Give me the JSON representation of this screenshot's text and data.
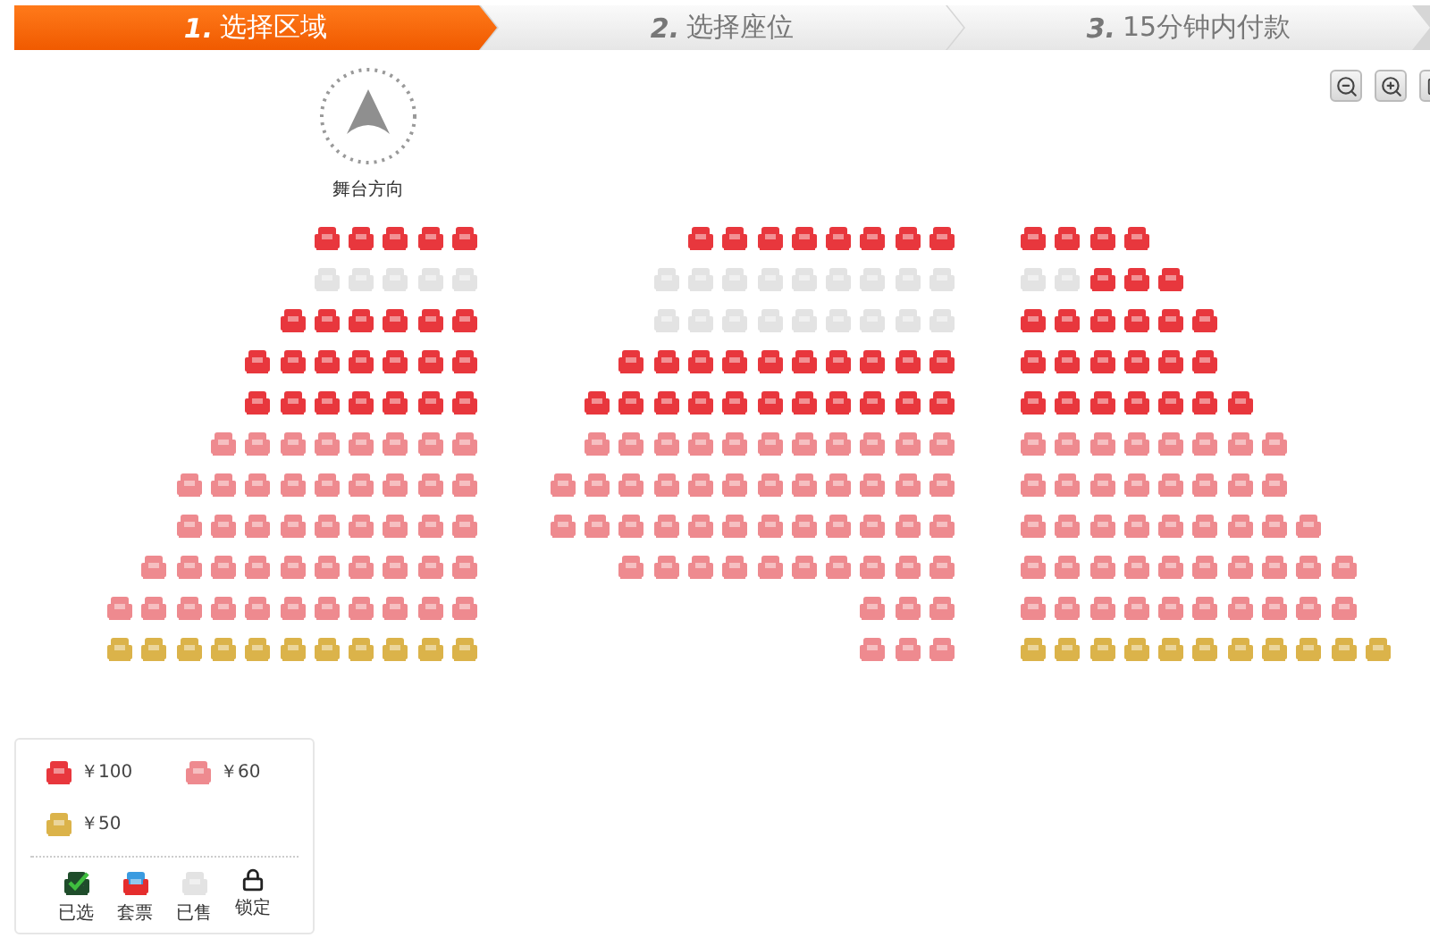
{
  "steps": [
    {
      "number": "1.",
      "label": "选择区域",
      "selected": true
    },
    {
      "number": "2.",
      "label": "选择座位",
      "selected": false
    },
    {
      "number": "3.",
      "label": "15分钟内付款",
      "selected": false
    }
  ],
  "stage": {
    "label": "舞台方向"
  },
  "zoom_buttons": [
    {
      "kind": "zoom-out"
    },
    {
      "kind": "zoom-in"
    },
    {
      "kind": "view"
    }
  ],
  "blocks": [
    {
      "kind": "left-wing",
      "rows": [
        {
          "seats": [
            {
              "kind": "tier1"
            },
            {
              "kind": "tier1"
            },
            {
              "kind": "tier1"
            },
            {
              "kind": "tier1"
            },
            {
              "kind": "tier1"
            }
          ]
        },
        {
          "seats": [
            {
              "kind": "sold"
            },
            {
              "kind": "sold"
            },
            {
              "kind": "sold"
            },
            {
              "kind": "sold"
            },
            {
              "kind": "sold"
            }
          ]
        },
        {
          "seats": [
            {
              "kind": "tier1"
            },
            {
              "kind": "tier1"
            },
            {
              "kind": "tier1"
            },
            {
              "kind": "tier1"
            },
            {
              "kind": "tier1"
            },
            {
              "kind": "tier1"
            }
          ]
        },
        {
          "seats": [
            {
              "kind": "tier1"
            },
            {
              "kind": "tier1"
            },
            {
              "kind": "tier1"
            },
            {
              "kind": "tier1"
            },
            {
              "kind": "tier1"
            },
            {
              "kind": "tier1"
            },
            {
              "kind": "tier1"
            }
          ]
        },
        {
          "seats": [
            {
              "kind": "tier1"
            },
            {
              "kind": "tier1"
            },
            {
              "kind": "tier1"
            },
            {
              "kind": "tier1"
            },
            {
              "kind": "tier1"
            },
            {
              "kind": "tier1"
            },
            {
              "kind": "tier1"
            }
          ]
        },
        {
          "seats": [
            {
              "kind": "tier2"
            },
            {
              "kind": "tier2"
            },
            {
              "kind": "tier2"
            },
            {
              "kind": "tier2"
            },
            {
              "kind": "tier2"
            },
            {
              "kind": "tier2"
            },
            {
              "kind": "tier2"
            },
            {
              "kind": "tier2"
            }
          ]
        },
        {
          "seats": [
            {
              "kind": "tier2"
            },
            {
              "kind": "tier2"
            },
            {
              "kind": "tier2"
            },
            {
              "kind": "tier2"
            },
            {
              "kind": "tier2"
            },
            {
              "kind": "tier2"
            },
            {
              "kind": "tier2"
            },
            {
              "kind": "tier2"
            },
            {
              "kind": "tier2"
            }
          ]
        },
        {
          "seats": [
            {
              "kind": "tier2"
            },
            {
              "kind": "tier2"
            },
            {
              "kind": "tier2"
            },
            {
              "kind": "tier2"
            },
            {
              "kind": "tier2"
            },
            {
              "kind": "tier2"
            },
            {
              "kind": "tier2"
            },
            {
              "kind": "tier2"
            },
            {
              "kind": "tier2"
            }
          ]
        },
        {
          "seats": [
            {
              "kind": "tier2"
            },
            {
              "kind": "tier2"
            },
            {
              "kind": "tier2"
            },
            {
              "kind": "tier2"
            },
            {
              "kind": "tier2"
            },
            {
              "kind": "tier2"
            },
            {
              "kind": "tier2"
            },
            {
              "kind": "tier2"
            },
            {
              "kind": "tier2"
            },
            {
              "kind": "tier2"
            }
          ]
        },
        {
          "seats": [
            {
              "kind": "tier2"
            },
            {
              "kind": "tier2"
            },
            {
              "kind": "tier2"
            },
            {
              "kind": "tier2"
            },
            {
              "kind": "tier2"
            },
            {
              "kind": "tier2"
            },
            {
              "kind": "tier2"
            },
            {
              "kind": "tier2"
            },
            {
              "kind": "tier2"
            },
            {
              "kind": "tier2"
            },
            {
              "kind": "tier2"
            }
          ]
        },
        {
          "seats": [
            {
              "kind": "tier3"
            },
            {
              "kind": "tier3"
            },
            {
              "kind": "tier3"
            },
            {
              "kind": "tier3"
            },
            {
              "kind": "tier3"
            },
            {
              "kind": "tier3"
            },
            {
              "kind": "tier3"
            },
            {
              "kind": "tier3"
            },
            {
              "kind": "tier3"
            },
            {
              "kind": "tier3"
            },
            {
              "kind": "tier3"
            }
          ]
        }
      ]
    },
    {
      "kind": "centre",
      "rows": [
        {
          "seats": [
            {
              "kind": "tier1"
            },
            {
              "kind": "tier1"
            },
            {
              "kind": "tier1"
            },
            {
              "kind": "tier1"
            },
            {
              "kind": "tier1"
            },
            {
              "kind": "tier1"
            },
            {
              "kind": "tier1"
            },
            {
              "kind": "tier1"
            }
          ]
        },
        {
          "seats": [
            {
              "kind": "sold"
            },
            {
              "kind": "sold"
            },
            {
              "kind": "sold"
            },
            {
              "kind": "sold"
            },
            {
              "kind": "sold"
            },
            {
              "kind": "sold"
            },
            {
              "kind": "sold"
            },
            {
              "kind": "sold"
            },
            {
              "kind": "sold"
            }
          ]
        },
        {
          "seats": [
            {
              "kind": "sold"
            },
            {
              "kind": "sold"
            },
            {
              "kind": "sold"
            },
            {
              "kind": "sold"
            },
            {
              "kind": "sold"
            },
            {
              "kind": "sold"
            },
            {
              "kind": "sold"
            },
            {
              "kind": "sold"
            },
            {
              "kind": "sold"
            }
          ]
        },
        {
          "seats": [
            {
              "kind": "tier1"
            },
            {
              "kind": "tier1"
            },
            {
              "kind": "tier1"
            },
            {
              "kind": "tier1"
            },
            {
              "kind": "tier1"
            },
            {
              "kind": "tier1"
            },
            {
              "kind": "tier1"
            },
            {
              "kind": "tier1"
            },
            {
              "kind": "tier1"
            },
            {
              "kind": "tier1"
            }
          ]
        },
        {
          "seats": [
            {
              "kind": "tier1"
            },
            {
              "kind": "tier1"
            },
            {
              "kind": "tier1"
            },
            {
              "kind": "tier1"
            },
            {
              "kind": "tier1"
            },
            {
              "kind": "tier1"
            },
            {
              "kind": "tier1"
            },
            {
              "kind": "tier1"
            },
            {
              "kind": "tier1"
            },
            {
              "kind": "tier1"
            },
            {
              "kind": "tier1"
            }
          ]
        },
        {
          "seats": [
            {
              "kind": "tier2"
            },
            {
              "kind": "tier2"
            },
            {
              "kind": "tier2"
            },
            {
              "kind": "tier2"
            },
            {
              "kind": "tier2"
            },
            {
              "kind": "tier2"
            },
            {
              "kind": "tier2"
            },
            {
              "kind": "tier2"
            },
            {
              "kind": "tier2"
            },
            {
              "kind": "tier2"
            },
            {
              "kind": "tier2"
            }
          ]
        },
        {
          "seats": [
            {
              "kind": "tier2"
            },
            {
              "kind": "tier2"
            },
            {
              "kind": "tier2"
            },
            {
              "kind": "tier2"
            },
            {
              "kind": "tier2"
            },
            {
              "kind": "tier2"
            },
            {
              "kind": "tier2"
            },
            {
              "kind": "tier2"
            },
            {
              "kind": "tier2"
            },
            {
              "kind": "tier2"
            },
            {
              "kind": "tier2"
            },
            {
              "kind": "tier2"
            }
          ]
        },
        {
          "seats": [
            {
              "kind": "tier2"
            },
            {
              "kind": "tier2"
            },
            {
              "kind": "tier2"
            },
            {
              "kind": "tier2"
            },
            {
              "kind": "tier2"
            },
            {
              "kind": "tier2"
            },
            {
              "kind": "tier2"
            },
            {
              "kind": "tier2"
            },
            {
              "kind": "tier2"
            },
            {
              "kind": "tier2"
            },
            {
              "kind": "tier2"
            },
            {
              "kind": "tier2"
            }
          ]
        },
        {
          "seats": [
            {
              "kind": "tier2"
            },
            {
              "kind": "tier2"
            },
            {
              "kind": "tier2"
            },
            {
              "kind": "tier2"
            },
            {
              "kind": "tier2"
            },
            {
              "kind": "tier2"
            },
            {
              "kind": "tier2"
            },
            {
              "kind": "tier2"
            },
            {
              "kind": "tier2"
            },
            {
              "kind": "tier2"
            }
          ]
        },
        {
          "seats": [
            {
              "kind": "tier2"
            },
            {
              "kind": "tier2"
            },
            {
              "kind": "tier2"
            }
          ]
        },
        {
          "seats": [
            {
              "kind": "tier2"
            },
            {
              "kind": "tier2"
            },
            {
              "kind": "tier2"
            }
          ]
        }
      ]
    },
    {
      "kind": "right-wing",
      "rows": [
        {
          "seats": [
            {
              "kind": "tier1"
            },
            {
              "kind": "tier1"
            },
            {
              "kind": "tier1"
            },
            {
              "kind": "tier1"
            }
          ]
        },
        {
          "seats": [
            {
              "kind": "sold"
            },
            {
              "kind": "sold"
            },
            {
              "kind": "tier1"
            },
            {
              "kind": "tier1"
            },
            {
              "kind": "tier1"
            }
          ]
        },
        {
          "seats": [
            {
              "kind": "tier1"
            },
            {
              "kind": "tier1"
            },
            {
              "kind": "tier1"
            },
            {
              "kind": "tier1"
            },
            {
              "kind": "tier1"
            },
            {
              "kind": "tier1"
            }
          ]
        },
        {
          "seats": [
            {
              "kind": "tier1"
            },
            {
              "kind": "tier1"
            },
            {
              "kind": "tier1"
            },
            {
              "kind": "tier1"
            },
            {
              "kind": "tier1"
            },
            {
              "kind": "tier1"
            }
          ]
        },
        {
          "seats": [
            {
              "kind": "tier1"
            },
            {
              "kind": "tier1"
            },
            {
              "kind": "tier1"
            },
            {
              "kind": "tier1"
            },
            {
              "kind": "tier1"
            },
            {
              "kind": "tier1"
            },
            {
              "kind": "tier1"
            }
          ]
        },
        {
          "seats": [
            {
              "kind": "tier2"
            },
            {
              "kind": "tier2"
            },
            {
              "kind": "tier2"
            },
            {
              "kind": "tier2"
            },
            {
              "kind": "tier2"
            },
            {
              "kind": "tier2"
            },
            {
              "kind": "tier2"
            },
            {
              "kind": "tier2"
            }
          ]
        },
        {
          "seats": [
            {
              "kind": "tier2"
            },
            {
              "kind": "tier2"
            },
            {
              "kind": "tier2"
            },
            {
              "kind": "tier2"
            },
            {
              "kind": "tier2"
            },
            {
              "kind": "tier2"
            },
            {
              "kind": "tier2"
            },
            {
              "kind": "tier2"
            }
          ]
        },
        {
          "seats": [
            {
              "kind": "tier2"
            },
            {
              "kind": "tier2"
            },
            {
              "kind": "tier2"
            },
            {
              "kind": "tier2"
            },
            {
              "kind": "tier2"
            },
            {
              "kind": "tier2"
            },
            {
              "kind": "tier2"
            },
            {
              "kind": "tier2"
            },
            {
              "kind": "tier2"
            }
          ]
        },
        {
          "seats": [
            {
              "kind": "tier2"
            },
            {
              "kind": "tier2"
            },
            {
              "kind": "tier2"
            },
            {
              "kind": "tier2"
            },
            {
              "kind": "tier2"
            },
            {
              "kind": "tier2"
            },
            {
              "kind": "tier2"
            },
            {
              "kind": "tier2"
            },
            {
              "kind": "tier2"
            },
            {
              "kind": "tier2"
            }
          ]
        },
        {
          "seats": [
            {
              "kind": "tier2"
            },
            {
              "kind": "tier2"
            },
            {
              "kind": "tier2"
            },
            {
              "kind": "tier2"
            },
            {
              "kind": "tier2"
            },
            {
              "kind": "tier2"
            },
            {
              "kind": "tier2"
            },
            {
              "kind": "tier2"
            },
            {
              "kind": "tier2"
            },
            {
              "kind": "tier2"
            }
          ]
        },
        {
          "seats": [
            {
              "kind": "tier3"
            },
            {
              "kind": "tier3"
            },
            {
              "kind": "tier3"
            },
            {
              "kind": "tier3"
            },
            {
              "kind": "tier3"
            },
            {
              "kind": "tier3"
            },
            {
              "kind": "tier3"
            },
            {
              "kind": "tier3"
            },
            {
              "kind": "tier3"
            },
            {
              "kind": "tier3"
            },
            {
              "kind": "tier3"
            }
          ]
        }
      ]
    }
  ],
  "legend": {
    "prices": [
      {
        "kind": "tier1",
        "label": "￥100"
      },
      {
        "kind": "tier2",
        "label": "￥60"
      },
      {
        "kind": "tier3",
        "label": "￥50"
      }
    ],
    "statuses": [
      {
        "kind": "selected",
        "label": "已选"
      },
      {
        "kind": "package",
        "label": "套票"
      },
      {
        "kind": "sold",
        "label": "已售"
      },
      {
        "kind": "locked",
        "label": "锁定"
      }
    ]
  }
}
